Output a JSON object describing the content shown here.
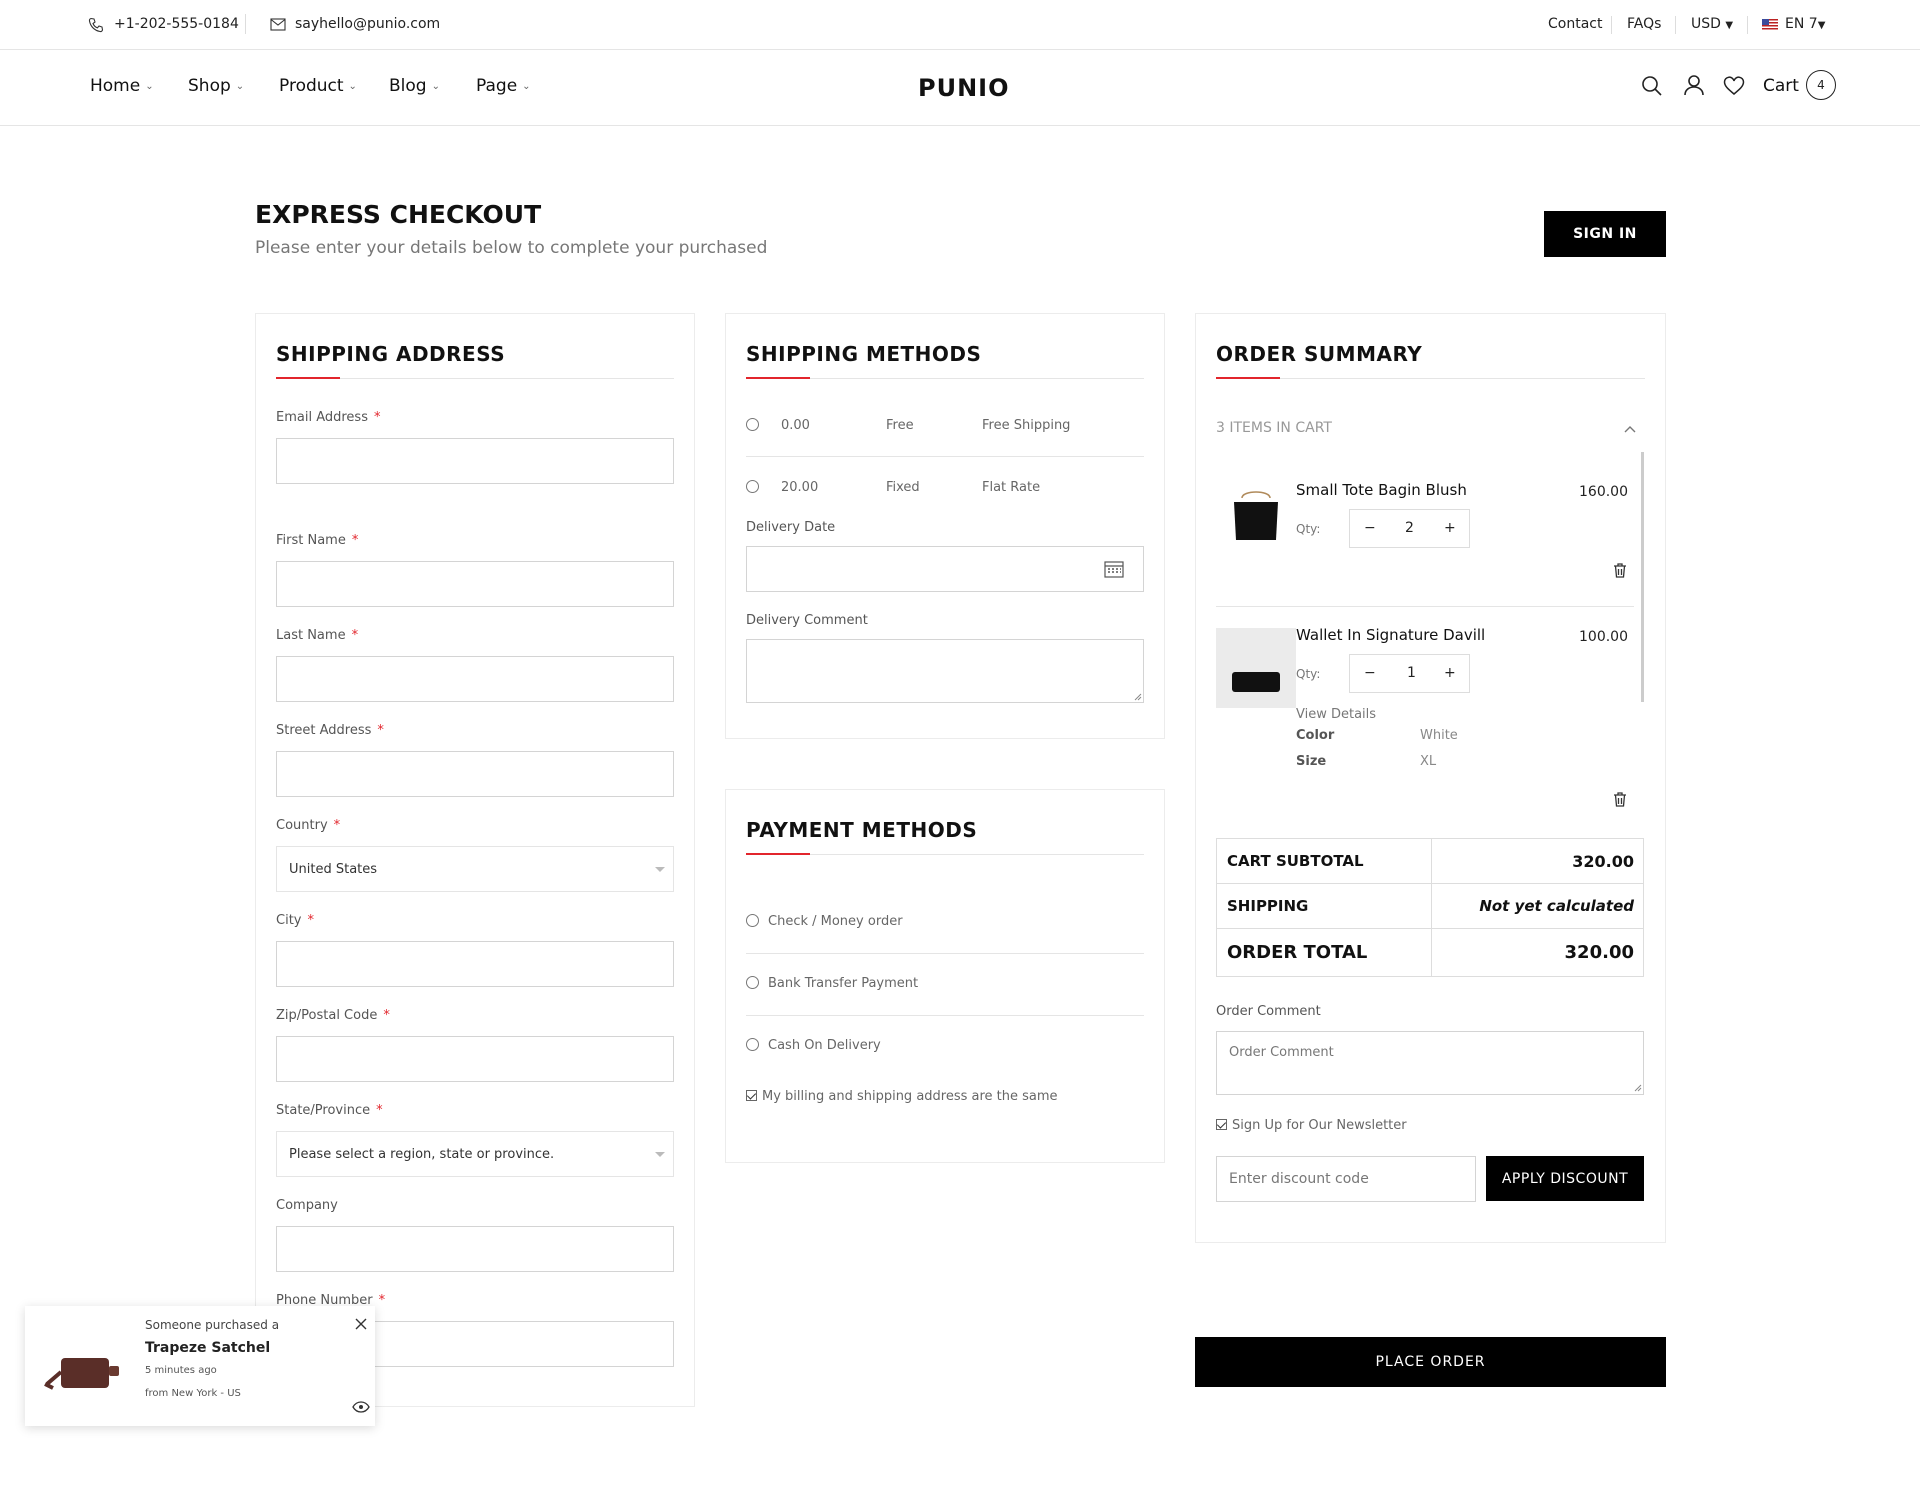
{
  "topbar": {
    "phone": "+1-202-555-0184",
    "email": "sayhello@punio.com",
    "links": [
      "Contact",
      "FAQs"
    ],
    "currency": "USD",
    "language": "EN 7"
  },
  "nav": {
    "menu": [
      "Home",
      "Shop",
      "Product",
      "Blog",
      "Page"
    ],
    "logo": "PUNIO",
    "cart_label": "Cart",
    "cart_count": "4"
  },
  "page": {
    "title": "EXPRESS CHECKOUT",
    "subtitle": "Please enter your details below to complete your purchased",
    "sign_in": "SIGN IN"
  },
  "shipping_address": {
    "title": "SHIPPING ADDRESS",
    "email_label": "Email Address",
    "first_name_label": "First Name",
    "last_name_label": "Last Name",
    "street_label": "Street Address",
    "country_label": "Country",
    "country_value": "United States",
    "city_label": "City",
    "zip_label": "Zip/Postal Code",
    "state_label": "State/Province",
    "state_value": "Please select a region, state or province.",
    "company_label": "Company",
    "phone_label": "Phone Number",
    "required_mark": "*"
  },
  "shipping_methods": {
    "title": "SHIPPING METHODS",
    "options": [
      {
        "price": "0.00",
        "type": "Free",
        "name": "Free Shipping"
      },
      {
        "price": "20.00",
        "type": "Fixed",
        "name": "Flat Rate"
      }
    ],
    "delivery_date_label": "Delivery Date",
    "delivery_comment_label": "Delivery Comment"
  },
  "payment_methods": {
    "title": "PAYMENT METHODS",
    "options": [
      "Check / Money order",
      "Bank Transfer Payment",
      "Cash On Delivery"
    ],
    "same_address_label": "My billing and shipping address are the same"
  },
  "order_summary": {
    "title": "ORDER SUMMARY",
    "items_in_cart": "3 ITEMS IN CART",
    "qty_label": "Qty:",
    "items": [
      {
        "name": "Small Tote Bagin Blush",
        "price": "160.00",
        "qty": "2"
      },
      {
        "name": "Wallet In Signature Davill",
        "price": "100.00",
        "qty": "1",
        "view_details": "View Details",
        "color_label": "Color",
        "color_value": "White",
        "size_label": "Size",
        "size_value": "XL"
      }
    ],
    "subtotal_label": "CART SUBTOTAL",
    "subtotal_value": "320.00",
    "shipping_label": "SHIPPING",
    "shipping_value": "Not yet calculated",
    "total_label": "ORDER TOTAL",
    "total_value": "320.00",
    "order_comment_label": "Order Comment",
    "order_comment_placeholder": "Order Comment",
    "newsletter_label": "Sign Up for Our Newsletter",
    "discount_placeholder": "Enter discount code",
    "apply_discount": "APPLY DISCOUNT",
    "place_order": "PLACE ORDER"
  },
  "popup": {
    "line1": "Someone purchased a",
    "product": "Trapeze Satchel",
    "time": "5 minutes ago",
    "location": "from New York - US"
  }
}
